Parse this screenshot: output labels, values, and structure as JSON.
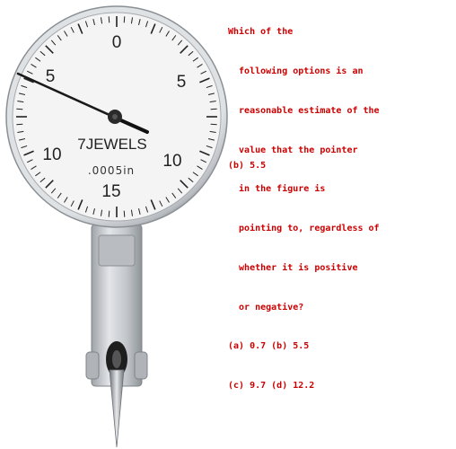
{
  "gauge": {
    "brand": "7JEWELS",
    "resolution": ".0005in",
    "dial_numbers": [
      "0",
      "5",
      "5",
      "10",
      "10",
      "15"
    ],
    "pointer_value": 5.5
  },
  "question": {
    "lines": [
      "Which of the",
      "  following options is an",
      "  reasonable estimate of the",
      "  value that the pointer",
      "  in the figure is",
      "  pointing to, regardless of",
      "  whether it is positive",
      "  or negative?",
      "(a) 0.7 (b) 5.5",
      "(c) 9.7 (d) 12.2"
    ]
  },
  "answer": "(b) 5.5",
  "colors": {
    "question_text": "#cc0000",
    "dial_face": "#f4f4f4",
    "bezel": "#c9ccd0",
    "pointer": "#1a1a1a"
  }
}
